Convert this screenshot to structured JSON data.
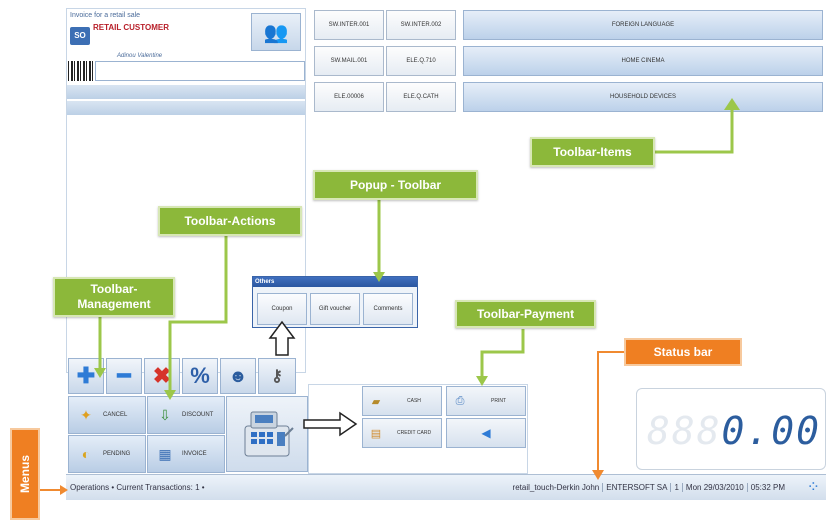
{
  "invoice": {
    "title": "Invoice for a retail sale",
    "customer": "RETAIL CUSTOMER",
    "user": "Adinou Valentine",
    "icon_label": "SO"
  },
  "items": [
    {
      "label": "SW.INTER.001"
    },
    {
      "label": "SW.INTER.002"
    },
    {
      "label": "SW.MAIL.001"
    },
    {
      "label": "ELE.Q.710"
    },
    {
      "label": "ELE.00006"
    },
    {
      "label": "ELE.Q.CATH"
    }
  ],
  "categories": [
    "FOREIGN LANGUAGE",
    "HOME CINEMA",
    "HOUSEHOLD DEVICES"
  ],
  "management_icons": [
    "plus-icon",
    "minus-icon",
    "delete-icon",
    "percent-icon",
    "person-icon",
    "key-icon"
  ],
  "actions": {
    "cancel": "CANCEL",
    "discount": "DISCOUNT",
    "pending": "PENDING",
    "invoice": "INVOICE"
  },
  "popup": {
    "title": "Others",
    "buttons": [
      "Coupon",
      "Gift voucher",
      "Comments"
    ]
  },
  "payment": {
    "cash": "CASH",
    "credit_card": "CREDIT CARD",
    "print": "PRINT"
  },
  "display": {
    "amount": "0.00",
    "ghost": "888"
  },
  "statusbar": {
    "left": "Operations • Current Transactions: 1 •",
    "user": "retail_touch-Derkin John",
    "company": "ENTERSOFT SA",
    "number": "1",
    "date": "Mon 29/03/2010",
    "time": "05:32 PM"
  },
  "callouts": {
    "toolbar_items": "Toolbar-Items",
    "popup_toolbar": "Popup - Toolbar",
    "toolbar_actions": "Toolbar-Actions",
    "toolbar_management": "Toolbar-\nManagement",
    "toolbar_payment": "Toolbar-Payment",
    "status_bar": "Status bar",
    "menus": "Menus"
  },
  "colors": {
    "callout_green": "#8cb83a",
    "callout_orange": "#ef7f22",
    "accent_blue": "#2c5d9e"
  }
}
